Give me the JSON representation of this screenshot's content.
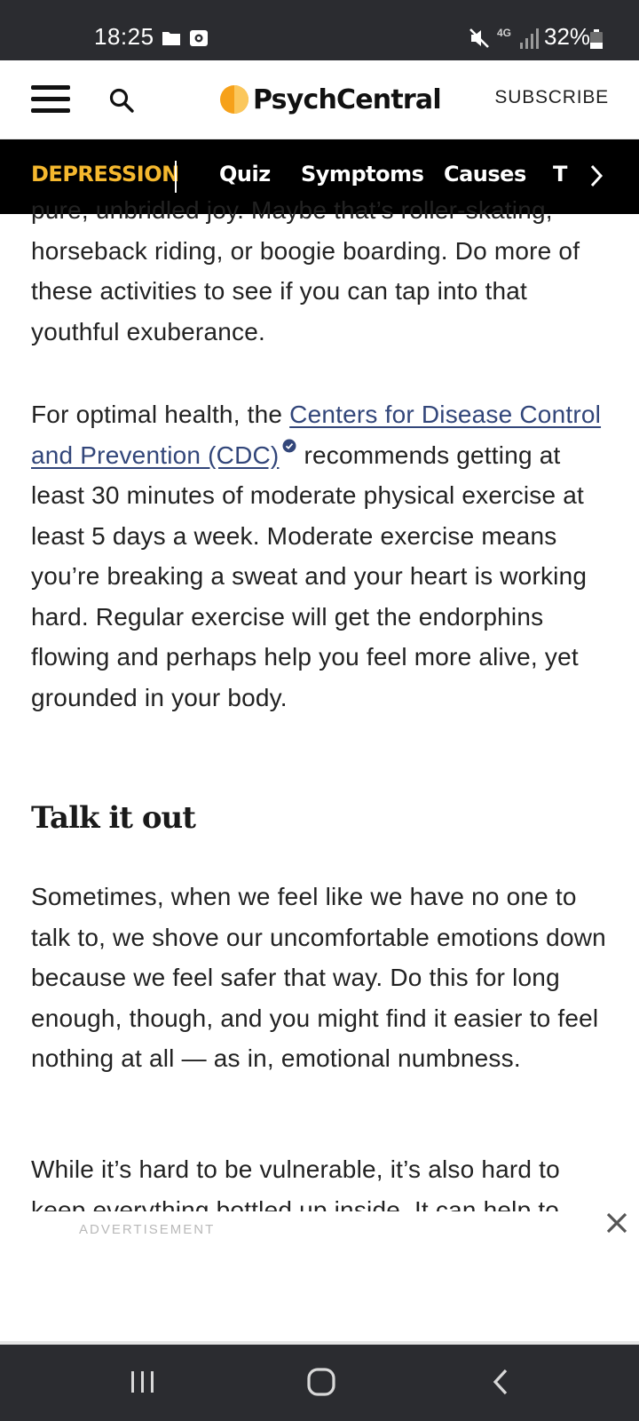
{
  "status_bar": {
    "time": "18:25",
    "network": "4G",
    "battery": "32%"
  },
  "header": {
    "brand": "PsychCentral",
    "subscribe": "SUBSCRIBE",
    "brand_color": "#f6a11a"
  },
  "topic_nav": {
    "current": "DEPRESSION",
    "links": [
      "Quiz",
      "Symptoms",
      "Causes",
      "T"
    ],
    "accent_color": "#f5b82e"
  },
  "article": {
    "paragraph1": "pure, unbridled joy. Maybe that’s roller-skating, horseback riding, or boogie boarding. Do more of these activities to see if you can tap into that youthful exuberance.",
    "paragraph2_before_link": "For optimal health, the ",
    "paragraph2_link": "Centers for Disease Control and Prevention (CDC)",
    "paragraph2_after_link": "recommends getting at least 30 minutes of moderate physical exercise at least 5 days a week. Moderate exercise means you’re breaking a sweat and your heart is working hard. Regular exercise will get the endorphins flowing and perhaps help you feel more alive, yet grounded in your body.",
    "heading": "Talk it out",
    "paragraph3": "Sometimes, when we feel like we have no one to talk to, we shove our uncomfortable emotions down because we feel safer that way. Do this for long enough, though, and you might find it easier to feel nothing at all — as in, emotional numbness.",
    "paragraph4": "While it’s hard to be vulnerable, it’s also hard to keep everything bottled up inside. It can help to",
    "link_color": "#32467a"
  },
  "ad": {
    "label": "ADVERTISEMENT"
  }
}
